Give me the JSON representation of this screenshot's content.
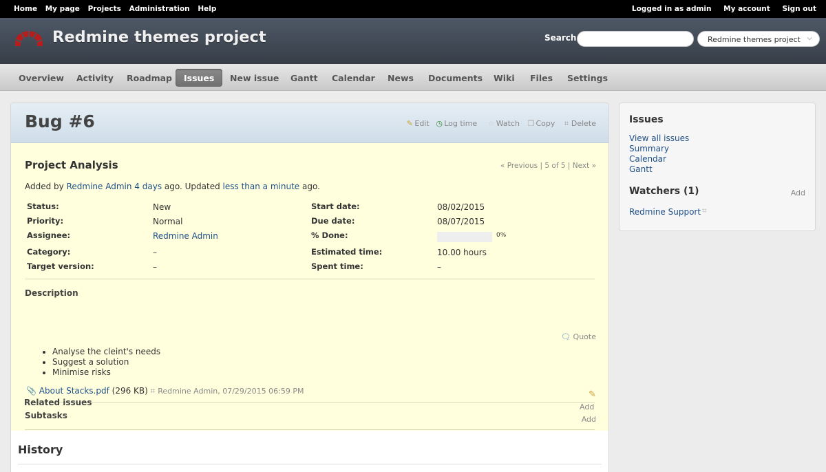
{
  "top_menu": {
    "items": [
      "Home",
      "My page",
      "Projects",
      "Administration",
      "Help"
    ],
    "logged_as_prefix": "Logged in as",
    "logged_as_user": "admin",
    "my_account": "My account",
    "sign_out": "Sign out"
  },
  "header": {
    "project_title": "Redmine themes project",
    "search_label": "Search:",
    "search_value": "",
    "project_jump": "Redmine themes project",
    "logo_icon": "redmine-logo-icon"
  },
  "main_menu": {
    "tabs": [
      "Overview",
      "Activity",
      "Roadmap",
      "Issues",
      "New issue",
      "Gantt",
      "Calendar",
      "News",
      "Documents",
      "Wiki",
      "Files",
      "Settings"
    ],
    "selected": "Issues"
  },
  "issue": {
    "title": "Bug #6",
    "actions": {
      "edit": "Edit",
      "log_time": "Log time",
      "watch": "Watch",
      "copy": "Copy",
      "delete": "Delete"
    },
    "subject": "Project Analysis",
    "pager": {
      "previous": "« Previous",
      "position": "5 of 5",
      "next": "Next »"
    },
    "author": {
      "added_by": "Added by",
      "author": "Redmine Admin",
      "created": "4 days",
      "ago_updated": "ago. Updated",
      "updated": "less than a minute",
      "ago": "ago."
    },
    "attributes_left": {
      "status_label": "Status:",
      "status": "New",
      "priority_label": "Priority:",
      "priority": "Normal",
      "assignee_label": "Assignee:",
      "assignee": "Redmine Admin",
      "category_label": "Category:",
      "category": "–",
      "target_label": "Target version:",
      "target": "–"
    },
    "attributes_right": {
      "start_label": "Start date:",
      "start": "08/02/2015",
      "due_label": "Due date:",
      "due": "08/07/2015",
      "done_label": "% Done:",
      "done": "0%",
      "done_fraction": 0,
      "estimated_label": "Estimated time:",
      "estimated": "10.00 hours",
      "spent_label": "Spent time:",
      "spent": "–"
    },
    "description": {
      "title": "Description",
      "quote": "Quote",
      "items": [
        "Analyse the cleint's needs",
        "Suggest a solution",
        "Minimise risks"
      ]
    },
    "attachment": {
      "name": "About Stacks.pdf",
      "size": "(296 KB)",
      "meta": "Redmine Admin, 07/29/2015 06:59 PM"
    },
    "subtasks": {
      "title": "Subtasks",
      "add": "Add"
    },
    "related": {
      "title": "Related issues",
      "add": "Add"
    },
    "history_title": "History"
  },
  "sidebar": {
    "issues_title": "Issues",
    "links": [
      "View all issues",
      "Summary",
      "Calendar",
      "Gantt"
    ],
    "watchers_title": "Watchers (1)",
    "watchers_add": "Add",
    "watcher": "Redmine Support"
  },
  "colors": {
    "top_bar": "#000000",
    "header": "#3f4752",
    "issue_background": "#ffffdd",
    "link": "#1e4f86"
  }
}
